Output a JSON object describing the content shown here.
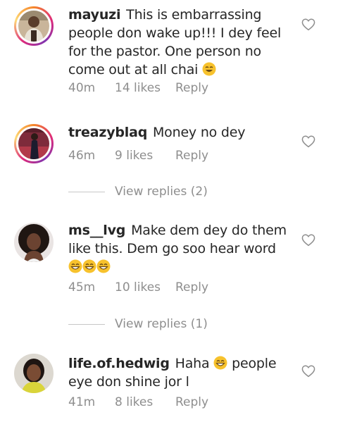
{
  "comments": [
    {
      "username": "mayuzi",
      "text": "This is embarrassing people don wake up!!! I dey feel for the pastor. One person no come out at all chai",
      "time": "40m",
      "likes": "14 likes",
      "reply": "Reply",
      "avatar": "avatar-man-icon"
    },
    {
      "username": "treazyblaq",
      "text": "Money no dey",
      "time": "46m",
      "likes": "9 likes",
      "reply": "Reply",
      "avatar": "avatar-woman-red-icon",
      "view_replies": "View replies (2)"
    },
    {
      "username": "ms__lvg",
      "text": "Make dem dey do them like this. Dem go soo hear word",
      "time": "45m",
      "likes": "10 likes",
      "reply": "Reply",
      "avatar": "avatar-woman-curly-icon",
      "view_replies": "View replies (1)"
    },
    {
      "username": "life.of.hedwig",
      "text_before": "Haha",
      "text_after": "people eye don shine jor l",
      "time": "41m",
      "likes": "8 likes",
      "reply": "Reply",
      "avatar": "avatar-woman-yellow-icon"
    }
  ],
  "icons": {
    "like": "heart-outline-icon",
    "emoji_smile": "smiling-face-icon",
    "emoji_grin": "grinning-face-icon"
  },
  "colors": {
    "muted": "#8e8e8e",
    "text": "#262626",
    "emoji": "#f7c22d"
  }
}
